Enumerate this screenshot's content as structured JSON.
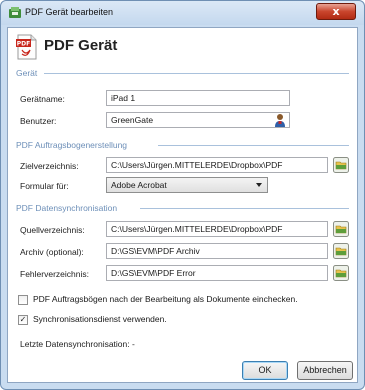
{
  "window": {
    "title": "PDF Gerät bearbeiten",
    "close_label": "x"
  },
  "header": {
    "title": "PDF Gerät",
    "logo_icon": "pdf-document-icon"
  },
  "sections": {
    "geraet": {
      "label": "Gerät",
      "fields": {
        "geraetname": {
          "label": "Gerätname:",
          "value": "iPad 1"
        },
        "benutzer": {
          "label": "Benutzer:",
          "value": "GreenGate",
          "button_icon": "user-icon"
        }
      }
    },
    "auftrag": {
      "label": "PDF Auftragsbogenerstellung",
      "fields": {
        "zielverzeichnis": {
          "label": "Zielverzeichnis:",
          "value": "C:\\Users\\Jürgen.MITTELERDE\\Dropbox\\PDF",
          "button_icon": "folder-icon"
        },
        "formular": {
          "label": "Formular für:",
          "value": "Adobe Acrobat"
        }
      }
    },
    "sync": {
      "label": "PDF Datensynchronisation",
      "fields": {
        "quellverzeichnis": {
          "label": "Quellverzeichnis:",
          "value": "C:\\Users\\Jürgen.MITTELERDE\\Dropbox\\PDF",
          "button_icon": "folder-icon"
        },
        "archiv": {
          "label": "Archiv (optional):",
          "value": "D:\\GS\\EVM\\PDF Archiv",
          "button_icon": "folder-icon"
        },
        "fehler": {
          "label": "Fehlerverzeichnis:",
          "value": "D:\\GS\\EVM\\PDF Error",
          "button_icon": "folder-icon"
        }
      }
    }
  },
  "options": {
    "checkin": {
      "label": "PDF Auftragsbögen nach der Bearbeitung als Dokumente einchecken.",
      "checked": false
    },
    "syncservice": {
      "label": "Synchronisationsdienst verwenden.",
      "checked": true,
      "mark": "✓"
    }
  },
  "status": {
    "last_sync": "Letzte Datensynchronisation: -"
  },
  "buttons": {
    "ok": "OK",
    "cancel": "Abbrechen"
  },
  "colors": {
    "accent": "#6d8fb8",
    "close": "#c9452d"
  }
}
